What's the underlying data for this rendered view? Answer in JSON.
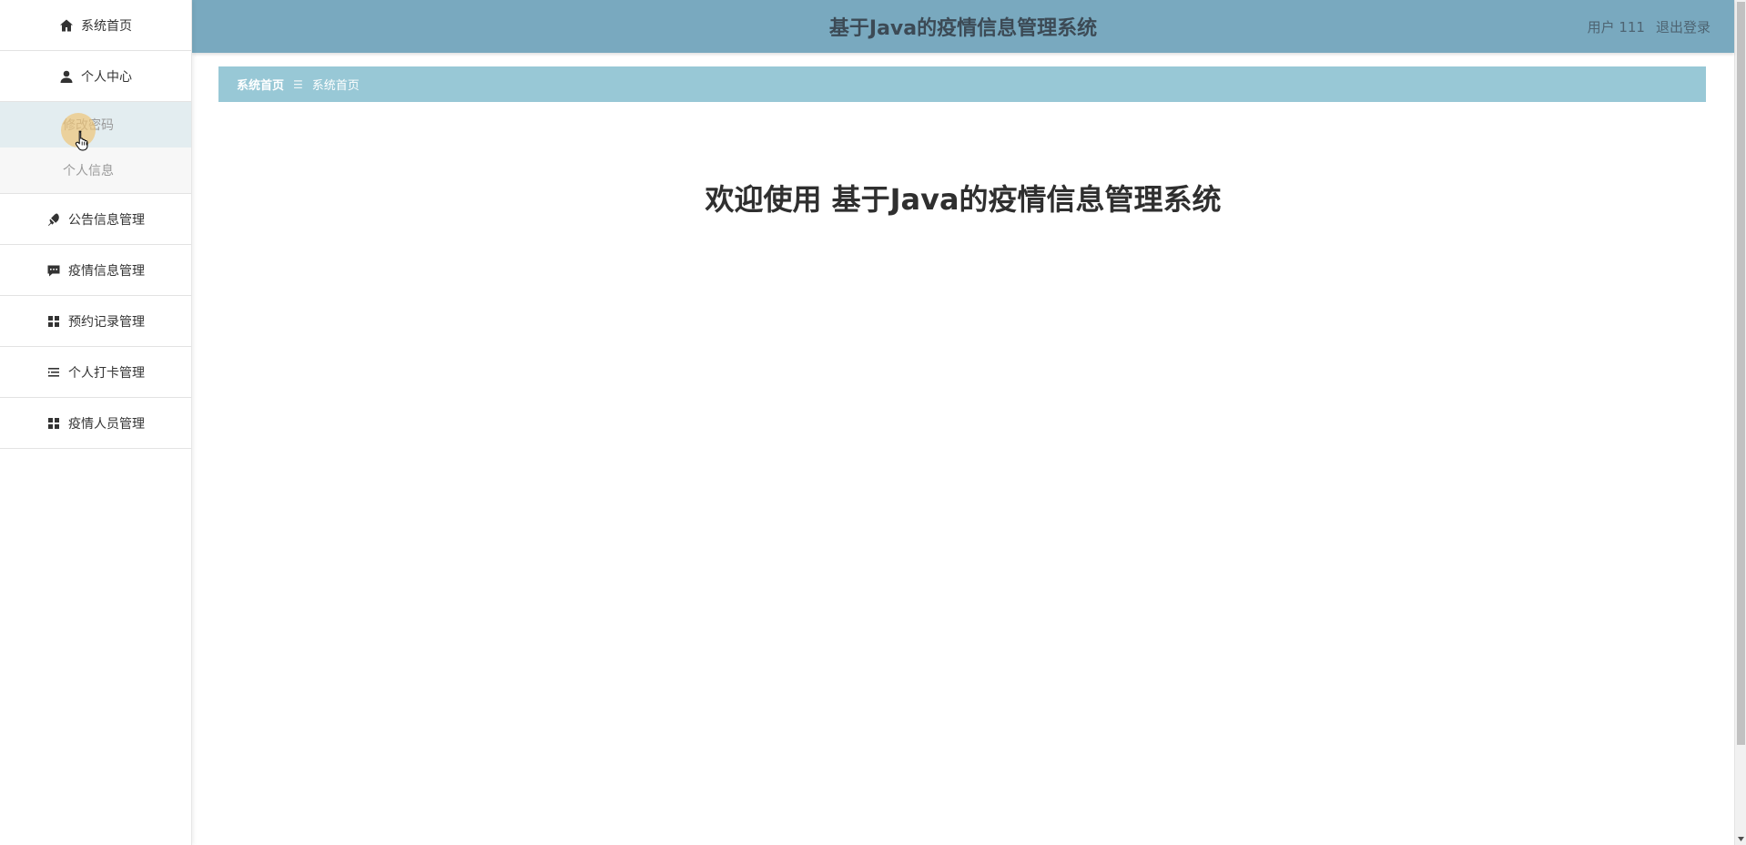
{
  "sidebar": {
    "items": [
      {
        "label": "系统首页",
        "icon": "home-icon"
      },
      {
        "label": "个人中心",
        "icon": "user-icon"
      },
      {
        "label": "公告信息管理",
        "icon": "pin-icon"
      },
      {
        "label": "疫情信息管理",
        "icon": "message-icon"
      },
      {
        "label": "预约记录管理",
        "icon": "grid-icon"
      },
      {
        "label": "个人打卡管理",
        "icon": "list-icon"
      },
      {
        "label": "疫情人员管理",
        "icon": "grid-icon"
      }
    ],
    "submenu": [
      {
        "label": "修改密码",
        "state": "hovered"
      },
      {
        "label": "个人信息"
      }
    ]
  },
  "header": {
    "title": "基于Java的疫情信息管理系统",
    "user": "用户 111",
    "logout": "退出登录"
  },
  "breadcrumb": {
    "items": [
      "系统首页",
      "系统首页"
    ],
    "separator": "☰"
  },
  "main": {
    "welcome": "欢迎使用 基于Java的疫情信息管理系统"
  },
  "colors": {
    "header_bg": "#79a9bf",
    "breadcrumb_bg": "#98c8d6",
    "submenu_active_bg": "#e3edf0"
  }
}
